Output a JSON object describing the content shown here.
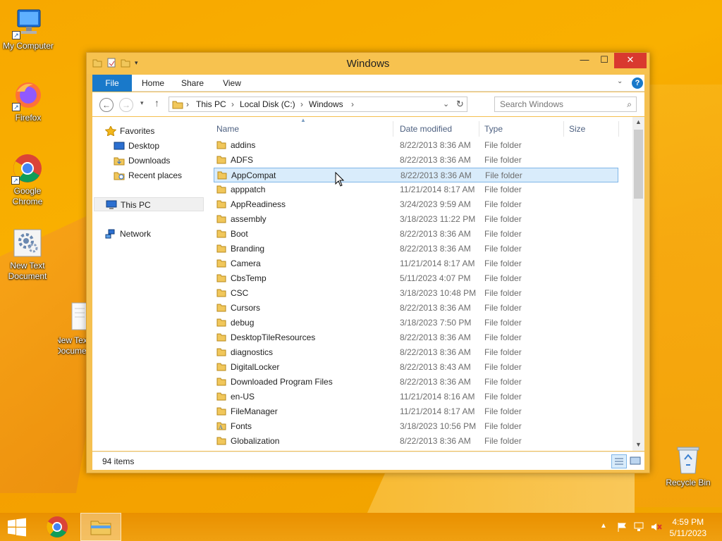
{
  "desktop": {
    "icons": [
      {
        "label": "My Computer"
      },
      {
        "label": "Firefox"
      },
      {
        "label": "Google Chrome"
      },
      {
        "label": "New Text Document"
      },
      {
        "label": "New Text Document"
      },
      {
        "label": "Recycle Bin"
      }
    ]
  },
  "window": {
    "title": "Windows",
    "ribbon_tabs": [
      "File",
      "Home",
      "Share",
      "View"
    ],
    "address": {
      "crumbs": [
        "This PC",
        "Local Disk (C:)",
        "Windows"
      ]
    },
    "search": {
      "placeholder": "Search Windows"
    },
    "nav": {
      "favorites": "Favorites",
      "favorites_items": [
        "Desktop",
        "Downloads",
        "Recent places"
      ],
      "this_pc": "This PC",
      "network": "Network"
    },
    "columns": [
      "Name",
      "Date modified",
      "Type",
      "Size"
    ],
    "rows": [
      {
        "name": "addins",
        "date": "8/22/2013 8:36 AM",
        "type": "File folder"
      },
      {
        "name": "ADFS",
        "date": "8/22/2013 8:36 AM",
        "type": "File folder"
      },
      {
        "name": "AppCompat",
        "date": "8/22/2013 8:36 AM",
        "type": "File folder",
        "selected": true
      },
      {
        "name": "apppatch",
        "date": "11/21/2014 8:17 AM",
        "type": "File folder"
      },
      {
        "name": "AppReadiness",
        "date": "3/24/2023 9:59 AM",
        "type": "File folder"
      },
      {
        "name": "assembly",
        "date": "3/18/2023 11:22 PM",
        "type": "File folder"
      },
      {
        "name": "Boot",
        "date": "8/22/2013 8:36 AM",
        "type": "File folder"
      },
      {
        "name": "Branding",
        "date": "8/22/2013 8:36 AM",
        "type": "File folder"
      },
      {
        "name": "Camera",
        "date": "11/21/2014 8:17 AM",
        "type": "File folder"
      },
      {
        "name": "CbsTemp",
        "date": "5/11/2023 4:07 PM",
        "type": "File folder"
      },
      {
        "name": "CSC",
        "date": "3/18/2023 10:48 PM",
        "type": "File folder"
      },
      {
        "name": "Cursors",
        "date": "8/22/2013 8:36 AM",
        "type": "File folder"
      },
      {
        "name": "debug",
        "date": "3/18/2023 7:50 PM",
        "type": "File folder"
      },
      {
        "name": "DesktopTileResources",
        "date": "8/22/2013 8:36 AM",
        "type": "File folder"
      },
      {
        "name": "diagnostics",
        "date": "8/22/2013 8:36 AM",
        "type": "File folder"
      },
      {
        "name": "DigitalLocker",
        "date": "8/22/2013 8:43 AM",
        "type": "File folder"
      },
      {
        "name": "Downloaded Program Files",
        "date": "8/22/2013 8:36 AM",
        "type": "File folder"
      },
      {
        "name": "en-US",
        "date": "11/21/2014 8:16 AM",
        "type": "File folder"
      },
      {
        "name": "FileManager",
        "date": "11/21/2014 8:17 AM",
        "type": "File folder"
      },
      {
        "name": "Fonts",
        "date": "3/18/2023 10:56 PM",
        "type": "File folder",
        "special": true
      },
      {
        "name": "Globalization",
        "date": "8/22/2013 8:36 AM",
        "type": "File folder"
      }
    ],
    "status": "94 items"
  },
  "taskbar": {
    "time": "4:59 PM",
    "date": "5/11/2023"
  },
  "colors": {
    "accent": "#1979ca",
    "selection_bg": "#d9ecfb",
    "selection_border": "#7fb6e8",
    "close": "#d9392f",
    "window_frame": "#f7c24f"
  }
}
